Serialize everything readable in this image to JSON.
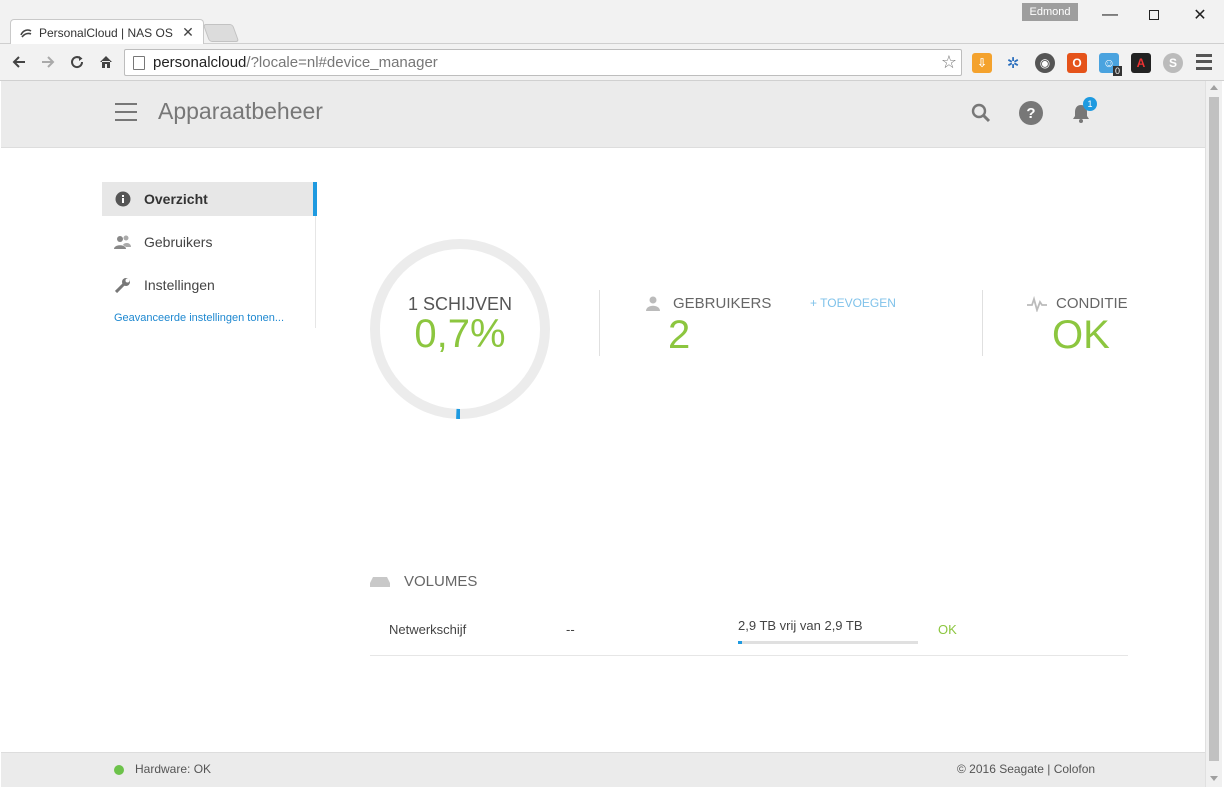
{
  "browser": {
    "tab_title": "PersonalCloud | NAS OS",
    "profile_name": "Edmond",
    "address_host": "personalcloud",
    "address_path": "/?locale=nl#device_manager",
    "extension_badge": "0"
  },
  "header": {
    "title": "Apparaatbeheer",
    "notification_count": "1"
  },
  "sidebar": {
    "items": [
      {
        "label": "Overzicht",
        "icon": "info-icon",
        "active": true
      },
      {
        "label": "Gebruikers",
        "icon": "users-icon",
        "active": false
      },
      {
        "label": "Instellingen",
        "icon": "wrench-icon",
        "active": false
      }
    ],
    "advanced_link": "Geavanceerde instellingen tonen..."
  },
  "overview": {
    "disks_label": "1 SCHIJVEN",
    "usage_percent_text": "0,7%",
    "usage_fraction": 0.007,
    "users_label": "GEBRUIKERS",
    "users_count": "2",
    "add_label": "+ TOEVOEGEN",
    "condition_label": "CONDITIE",
    "condition_value": "OK"
  },
  "volumes": {
    "heading": "VOLUMES",
    "rows": [
      {
        "name": "Netwerkschijf",
        "info": "--",
        "capacity": "2,9 TB vrij van 2,9 TB",
        "used_fraction": 0.02,
        "status": "OK"
      }
    ]
  },
  "footer": {
    "hardware_status": "Hardware: OK",
    "copyright": "© 2016 Seagate | Colofon"
  },
  "colors": {
    "accent_green": "#8cc63f",
    "accent_blue": "#1e9ae0"
  }
}
